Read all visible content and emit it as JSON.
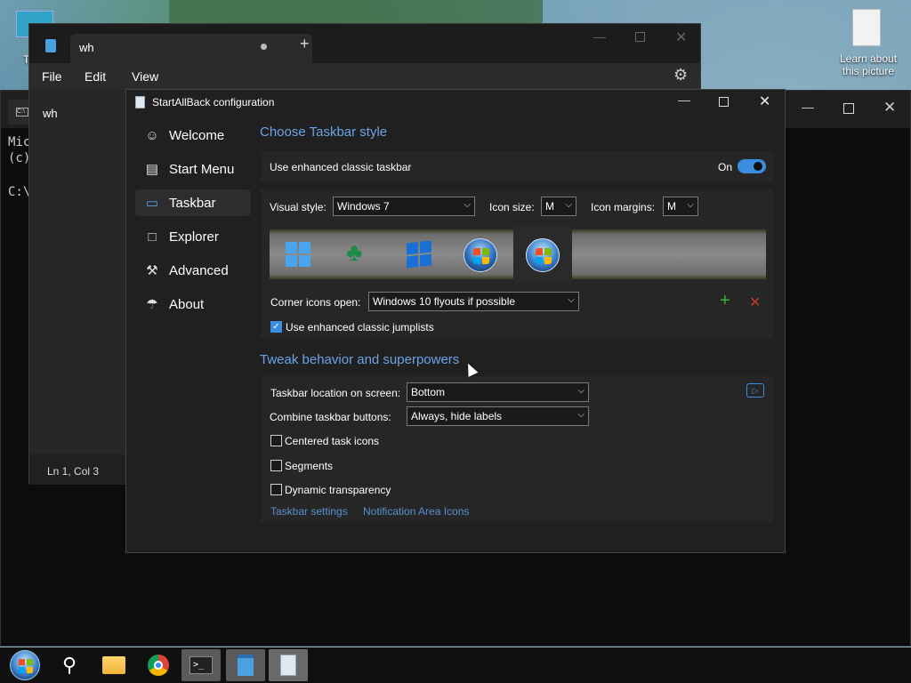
{
  "desktop": {
    "icon_left_label": "Th",
    "icon_right_label_1": "Learn about",
    "icon_right_label_2": "this picture"
  },
  "terminal": {
    "tab_title": "",
    "lines": [
      "Mic",
      "(c)",
      "",
      "C:\\"
    ]
  },
  "notepad": {
    "tab_title": "wh",
    "menu": [
      "File",
      "Edit",
      "View"
    ],
    "content": "wh",
    "status": "Ln 1, Col 3"
  },
  "config": {
    "title": "StartAllBack configuration",
    "nav": [
      {
        "label": "Welcome",
        "icon": "smiley-icon"
      },
      {
        "label": "Start Menu",
        "icon": "start-menu-icon"
      },
      {
        "label": "Taskbar",
        "icon": "taskbar-icon"
      },
      {
        "label": "Explorer",
        "icon": "folder-icon"
      },
      {
        "label": "Advanced",
        "icon": "wrench-icon"
      },
      {
        "label": "About",
        "icon": "about-icon"
      }
    ],
    "style_section": {
      "title": "Choose Taskbar style",
      "enhanced_label": "Use enhanced classic taskbar",
      "toggle_state": "On",
      "visual_style_label": "Visual style:",
      "visual_style_value": "Windows 7",
      "icon_size_label": "Icon size:",
      "icon_size_value": "M",
      "icon_margins_label": "Icon margins:",
      "icon_margins_value": "M",
      "corner_label": "Corner icons open:",
      "corner_value": "Windows 10 flyouts if possible",
      "jumplists_label": "Use enhanced classic jumplists"
    },
    "tweak_section": {
      "title": "Tweak behavior and superpowers",
      "location_label": "Taskbar location on screen:",
      "location_value": "Bottom",
      "combine_label": "Combine taskbar buttons:",
      "combine_value": "Always, hide labels",
      "centered_label": "Centered task icons",
      "segments_label": "Segments",
      "dynamic_label": "Dynamic transparency",
      "link1": "Taskbar settings",
      "link2": "Notification Area Icons"
    }
  },
  "taskbar": {
    "items": [
      "start-orb-icon",
      "search-icon",
      "file-explorer-icon",
      "chrome-icon",
      "terminal-icon",
      "notepad-icon",
      "startallback-icon"
    ]
  },
  "colors": {
    "accent": "#3b8de0",
    "section_title": "#6aa3e8",
    "link": "#5a8fd0"
  }
}
